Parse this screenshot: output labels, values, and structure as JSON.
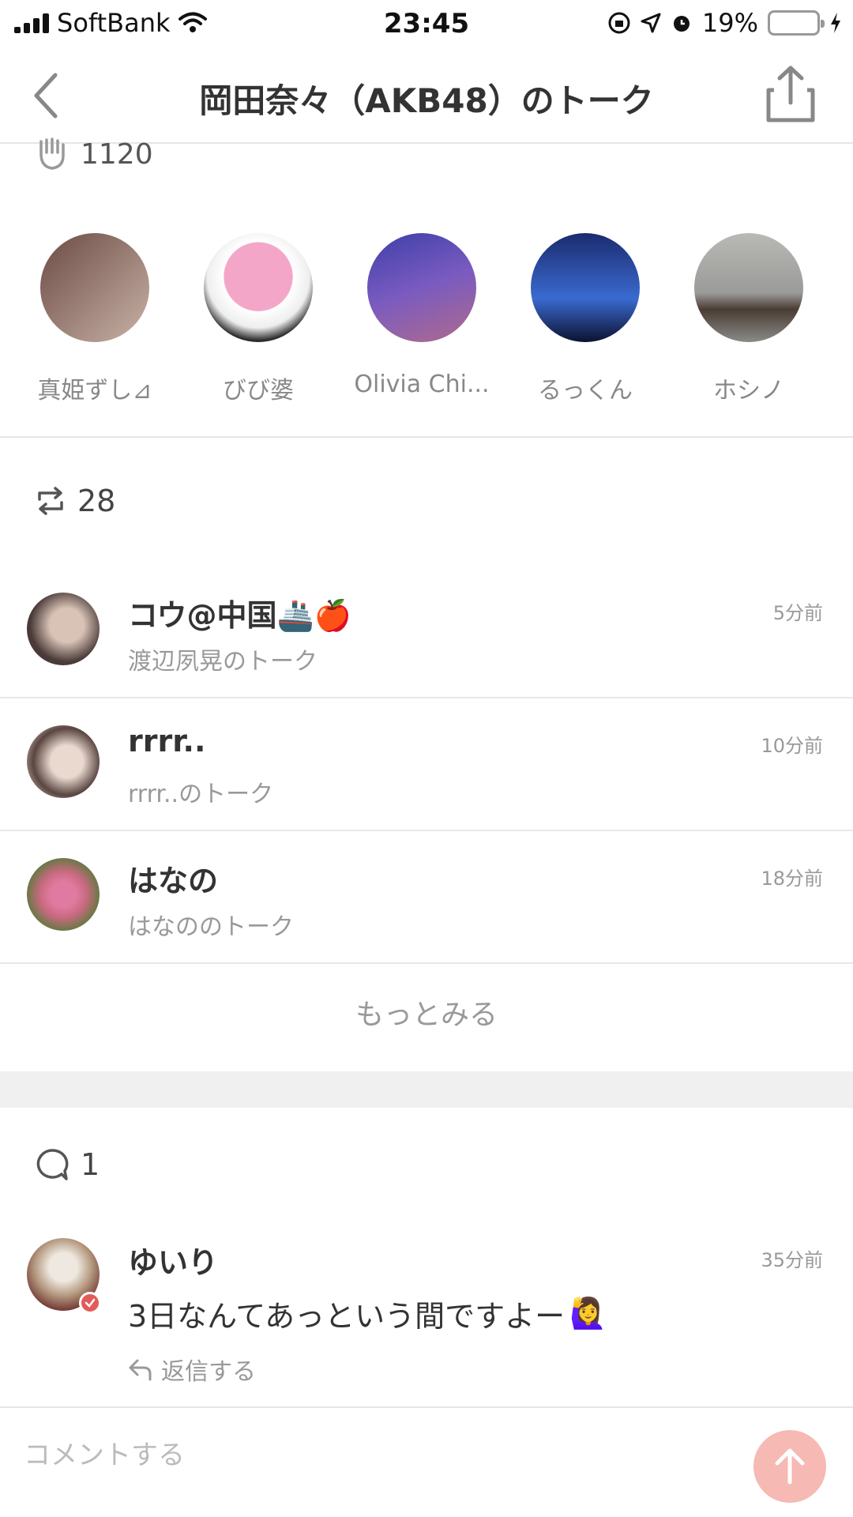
{
  "status_bar": {
    "carrier": "SoftBank",
    "time": "23:45",
    "battery_percent": "19%",
    "battery_level": 0.19
  },
  "nav": {
    "title": "岡田奈々（AKB48）のトーク",
    "back_icon": "chevron-left-icon",
    "share_icon": "share-icon"
  },
  "claps": {
    "count": "1120",
    "icon": "clap-icon"
  },
  "clappers": [
    {
      "name": "真姫ずし⊿",
      "colors": [
        "#6b4b45",
        "#c9b2a6"
      ]
    },
    {
      "name": "びび婆",
      "colors": [
        "#f4a6c8",
        "#2b2b2b"
      ]
    },
    {
      "name": "Olivia Chi...",
      "colors": [
        "#3d3fa8",
        "#b06a8c"
      ]
    },
    {
      "name": "るっくん",
      "colors": [
        "#1b2b6e",
        "#3a6ad0"
      ]
    },
    {
      "name": "ホシノ",
      "colors": [
        "#9a9a98",
        "#4a3c34"
      ]
    }
  ],
  "reposts": {
    "count": "28",
    "icon": "repost-icon"
  },
  "reposters": [
    {
      "name": "コウ@中国🚢🍎",
      "talk": "渡辺夙晃のトーク",
      "time": "5分前",
      "colors": [
        "#4a3a38",
        "#d8c3b6"
      ]
    },
    {
      "name": "rrrr..",
      "talk": "rrrr..のトーク",
      "time": "10分前",
      "colors": [
        "#e9d9cf",
        "#5a4540"
      ]
    },
    {
      "name": "はなの",
      "talk": "はなののトーク",
      "time": "18分前",
      "colors": [
        "#e07aa0",
        "#5b7a3c"
      ]
    }
  ],
  "more_label": "もっとみる",
  "comments_count": {
    "count": "1",
    "icon": "comment-bubble-icon"
  },
  "comment": {
    "name": "ゆいり",
    "time": "35分前",
    "text": "3日なんてあっという間ですよー",
    "emoji": "🙋‍♀️",
    "reply_label": "返信する"
  },
  "input": {
    "placeholder": "コメントする"
  },
  "colors": {
    "accent": "#f6b9b3",
    "verified": "#e25b5b",
    "battery_fill": "#f3c300"
  }
}
